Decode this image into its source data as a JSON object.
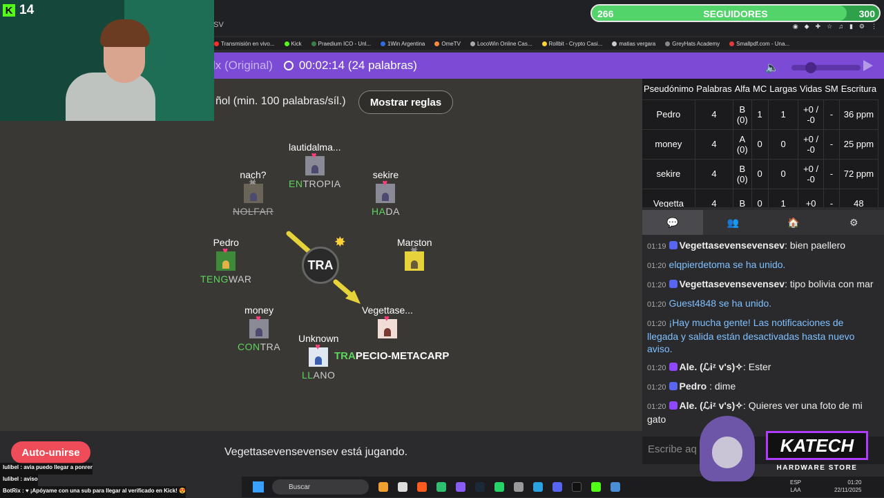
{
  "browser": {
    "address_text": "...SV",
    "bookmarks": [
      {
        "label": "Transmisión en vivo...",
        "color": "#ff2d2d"
      },
      {
        "label": "Kick",
        "color": "#53fc18"
      },
      {
        "label": "Praedium ICO - Unl...",
        "color": "#3b7d4a"
      },
      {
        "label": "1Win Argentina",
        "color": "#2f6de0"
      },
      {
        "label": "OmeTV",
        "color": "#ff8a3d"
      },
      {
        "label": "LocoWin Online Cas...",
        "color": "#aaaaaa"
      },
      {
        "label": "Rollbit - Crypto Casi...",
        "color": "#ffd23a"
      },
      {
        "label": "matias vergara",
        "color": "#cccccc"
      },
      {
        "label": "GreyHats Academy",
        "color": "#888888"
      },
      {
        "label": "Smallpdf.com - Una...",
        "color": "#e23b3b"
      }
    ]
  },
  "game": {
    "title": "lx (Original)",
    "timer": "00:02:14 (24 palabras)",
    "rules_text": "ñol (min. 100 palabras/síl.)",
    "rules_button": "Mostrar reglas",
    "bomb_syllable": "TRA",
    "status": "Vegettasevensevensev está jugando.",
    "auto_join": "Auto-unirse",
    "players": [
      {
        "name": "lautidalma...",
        "word_hl": "EN",
        "word_rest": "TROPIA",
        "dead": false
      },
      {
        "name": "sekire",
        "word_hl": "HA",
        "word_rest": "DA",
        "dead": false
      },
      {
        "name": "nach?",
        "word_hl": "",
        "word_rest": "NOLFAR",
        "dead": true
      },
      {
        "name": "Pedro",
        "word_hl": "TENG",
        "word_rest": "WAR",
        "dead": false
      },
      {
        "name": "Marston",
        "word_hl": "",
        "word_rest": "",
        "dead": true
      },
      {
        "name": "money",
        "word_hl": "CON",
        "word_rest": "TRA",
        "dead": false
      },
      {
        "name": "Vegettase...",
        "word_hl": "",
        "word_rest": "",
        "dead": false
      },
      {
        "name": "Unknown",
        "word_hl": "LL",
        "word_rest": "ANO",
        "dead": false
      }
    ],
    "current_typing": {
      "hl": "TRA",
      "rest": "PECIO-METACARP"
    }
  },
  "scoreboard": {
    "headers": [
      "Pseudónimo",
      "Palabras",
      "Alfa",
      "MC",
      "Largas",
      "Vidas",
      "SM",
      "Escritura"
    ],
    "rows": [
      [
        "Pedro",
        "4",
        "B (0)",
        "1",
        "1",
        "+0 / -0",
        "-",
        "36 ppm"
      ],
      [
        "money",
        "4",
        "A (0)",
        "0",
        "0",
        "+0 / -0",
        "-",
        "25 ppm"
      ],
      [
        "sekire",
        "4",
        "B (0)",
        "0",
        "0",
        "+0 / -0",
        "-",
        "72 ppm"
      ],
      [
        "Vegetta",
        "4",
        "B",
        "0",
        "1",
        "+0",
        "-",
        "48"
      ]
    ]
  },
  "chat": {
    "messages": [
      {
        "time": "01:19",
        "user": "Vegettasevensevensev",
        "text": ": bien paellero",
        "system": false,
        "platform": "discord"
      },
      {
        "time": "01:20",
        "user": "",
        "text": "elqpierdetoma se ha unido.",
        "system": true,
        "platform": ""
      },
      {
        "time": "01:20",
        "user": "Vegettasevensevensev",
        "text": ": tipo bolivia con mar",
        "system": false,
        "platform": "discord"
      },
      {
        "time": "01:20",
        "user": "",
        "text": "Guest4848 se ha unido.",
        "system": true,
        "platform": ""
      },
      {
        "time": "01:20",
        "user": "",
        "text": "¡Hay mucha gente! Las notificaciones de llegada y salida están desactivadas hasta nuevo aviso.",
        "system": true,
        "platform": ""
      },
      {
        "time": "01:20",
        "user": "Ale. (ℒiᶻ v's)✧",
        "text": ": Ester",
        "system": false,
        "platform": "twitch"
      },
      {
        "time": "01:20",
        "user": "Pedro",
        "text": " : dime",
        "system": false,
        "platform": "discord"
      },
      {
        "time": "01:20",
        "user": "Ale. (ℒiᶻ v's)✧",
        "text": ": Quieres ver una foto de mi gato",
        "system": false,
        "platform": "twitch"
      }
    ],
    "input_placeholder": "Escribe aq"
  },
  "overlay": {
    "kick_count": "14",
    "followers_current": "266",
    "followers_label": "SEGUIDORES",
    "followers_goal": "300",
    "followers_progress": 0.887,
    "stream_chat": [
      "lulibel : avia puedo llegar a ponrer",
      "lulibel : aviso",
      "BotRix : ♥ ¡Apóyame con una sub para llegar al verificado en Kick! 😍"
    ],
    "sponsor_name": "KATECH",
    "sponsor_tagline": "HARDWARE STORE"
  },
  "taskbar": {
    "search": "Buscar",
    "lang_1": "ESP",
    "lang_2": "LAA",
    "time": "01:20",
    "date": "22/11/2025"
  },
  "colors": {
    "header_purple": "#7b4bd6",
    "highlight_green": "#5cd65c",
    "autojoin_red": "#ee4c58",
    "heart_pink": "#ff3d7f",
    "system_blue": "#7fc0ff"
  }
}
